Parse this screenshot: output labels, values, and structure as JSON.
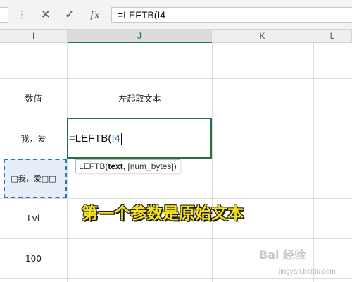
{
  "formula_bar": {
    "grip_icon": "vertical-dots",
    "cancel_icon": "✕",
    "enter_icon": "✓",
    "function_icon": "fx",
    "formula_text": "=LEFTB(I4"
  },
  "columns": [
    {
      "letter": "I",
      "selected": false
    },
    {
      "letter": "J",
      "selected": true
    },
    {
      "letter": "K",
      "selected": false
    },
    {
      "letter": "L",
      "selected": false
    }
  ],
  "cells": {
    "i_header": "数值",
    "j_header": "左起取文本",
    "i_row2": "我，爱",
    "i_row3": "\u0000我，爱\u0000\u0000",
    "i_row3_display": "□我，爱□□",
    "i_row4": "Lvi",
    "i_row5": "100"
  },
  "editing_cell": {
    "prefix": "=LEFTB(",
    "reference": "I4"
  },
  "tooltip": {
    "function_name": "LEFTB(",
    "arg_bold": "text",
    "rest": ", [num_bytes])"
  },
  "annotation": "第一个参数是原始文本",
  "watermark": {
    "text": "Bai 经验",
    "sub": "jingyan.baidu.com"
  },
  "colors": {
    "selection_green": "#217346",
    "reference_blue": "#3b6fb6",
    "marquee_blue": "#2f74b8",
    "annotation_yellow": "#f6e21a"
  }
}
